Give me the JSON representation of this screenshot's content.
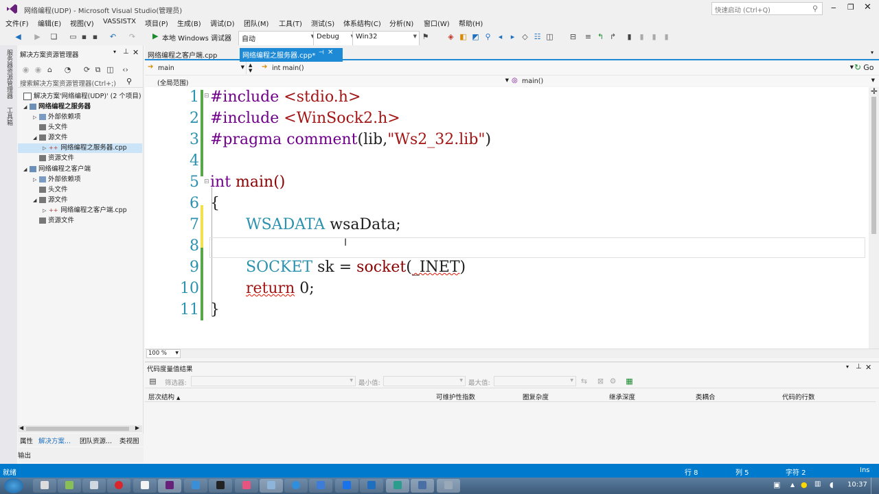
{
  "window": {
    "title": "网络编程(UDP) - Microsoft Visual Studio(管理员)",
    "quick_launch_placeholder": "快速启动 (Ctrl+Q)"
  },
  "menu": [
    "文件(F)",
    "编辑(E)",
    "视图(V)",
    "VASSISTX",
    "项目(P)",
    "生成(B)",
    "调试(D)",
    "团队(M)",
    "工具(T)",
    "测试(S)",
    "体系结构(C)",
    "分析(N)",
    "窗口(W)",
    "帮助(H)"
  ],
  "toolbar": {
    "debugger_label": "本地 Windows 调试器",
    "config_auto": "自动",
    "config_debug": "Debug",
    "platform": "Win32"
  },
  "leftstrip": {
    "server_explorer": "服务器资源管理器",
    "toolbox": "工具箱"
  },
  "solution_explorer": {
    "title": "解决方案资源管理器",
    "search_placeholder": "搜索解决方案资源管理器(Ctrl+;)",
    "items": [
      {
        "label": "解决方案'网络编程(UDP)' (2 个项目)",
        "level": 0
      },
      {
        "label": "网络编程之服务器",
        "level": 1,
        "bold": true
      },
      {
        "label": "外部依赖项",
        "level": 2
      },
      {
        "label": "头文件",
        "level": 2
      },
      {
        "label": "源文件",
        "level": 2
      },
      {
        "label": "网络编程之服务器.cpp",
        "level": 3,
        "selected": true
      },
      {
        "label": "资源文件",
        "level": 2
      },
      {
        "label": "网络编程之客户端",
        "level": 1
      },
      {
        "label": "外部依赖项",
        "level": 2
      },
      {
        "label": "头文件",
        "level": 2
      },
      {
        "label": "源文件",
        "level": 2
      },
      {
        "label": "网络编程之客户端.cpp",
        "level": 3
      },
      {
        "label": "资源文件",
        "level": 2
      }
    ],
    "bottom_tabs": [
      "属性",
      "解决方案...",
      "团队资源...",
      "类视图"
    ],
    "output_tab": "输出"
  },
  "editor": {
    "tabs": [
      {
        "label": "网络编程之客户端.cpp",
        "active": false
      },
      {
        "label": "网络编程之服务器.cpp*",
        "active": true
      }
    ],
    "nav_scope": "main",
    "nav_function": "int main()",
    "nav_go": "Go",
    "scope_global": "(全局范围)",
    "scope_member": "main()",
    "zoom": "100 %",
    "lines": [
      "1",
      "2",
      "3",
      "4",
      "5",
      "6",
      "7",
      "8",
      "9",
      "10",
      "11"
    ],
    "code": {
      "l1a": "#include ",
      "l1b": "<stdio.h>",
      "l2a": "#include ",
      "l2b": "<WinSock2.h>",
      "l3a": "#pragma comment",
      "l3b": "(lib,",
      "l3c": "\"Ws2_32.lib\"",
      "l3d": ")",
      "l5a": "int",
      "l5b": " main()",
      "l6": "{",
      "l7a": "WSADATA",
      "l7b": " wsaData;",
      "l9a": "SOCKET",
      "l9b": " sk = ",
      "l9c": "socket",
      "l9d": "(",
      "l9e": "_INET",
      "l9f": ")",
      "l10a": "return",
      "l10b": " 0;",
      "l11": "}"
    }
  },
  "metrics": {
    "title": "代码度量值结果",
    "filter_label": "筛选器:",
    "min_label": "最小值:",
    "max_label": "最大值:",
    "columns": [
      "层次结构",
      "可维护性指数",
      "圈复杂度",
      "继承深度",
      "类耦合",
      "代码的行数"
    ]
  },
  "status": {
    "ready": "就绪",
    "line": "行 8",
    "col": "列 5",
    "char": "字符 2",
    "mode": "Ins"
  },
  "taskbar": {
    "time": "10:37"
  }
}
